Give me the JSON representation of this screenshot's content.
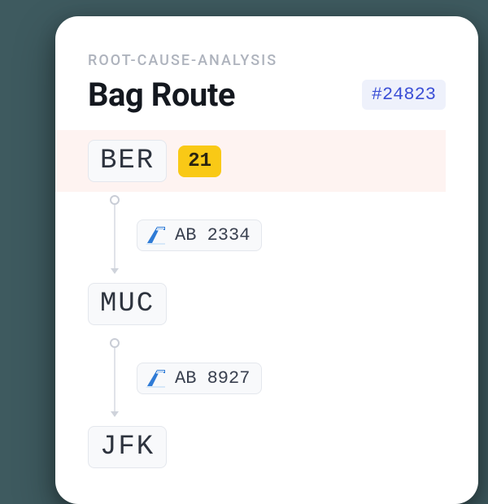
{
  "header": {
    "eyebrow": "ROOT-CAUSE-ANALYSIS",
    "title": "Bag Route",
    "case_id": "#24823"
  },
  "route": {
    "stops": [
      {
        "code": "BER",
        "count": "21",
        "highlighted": true
      },
      {
        "code": "MUC"
      },
      {
        "code": "JFK"
      }
    ],
    "legs": [
      {
        "flight": "AB 2334"
      },
      {
        "flight": "AB 8927"
      }
    ]
  }
}
